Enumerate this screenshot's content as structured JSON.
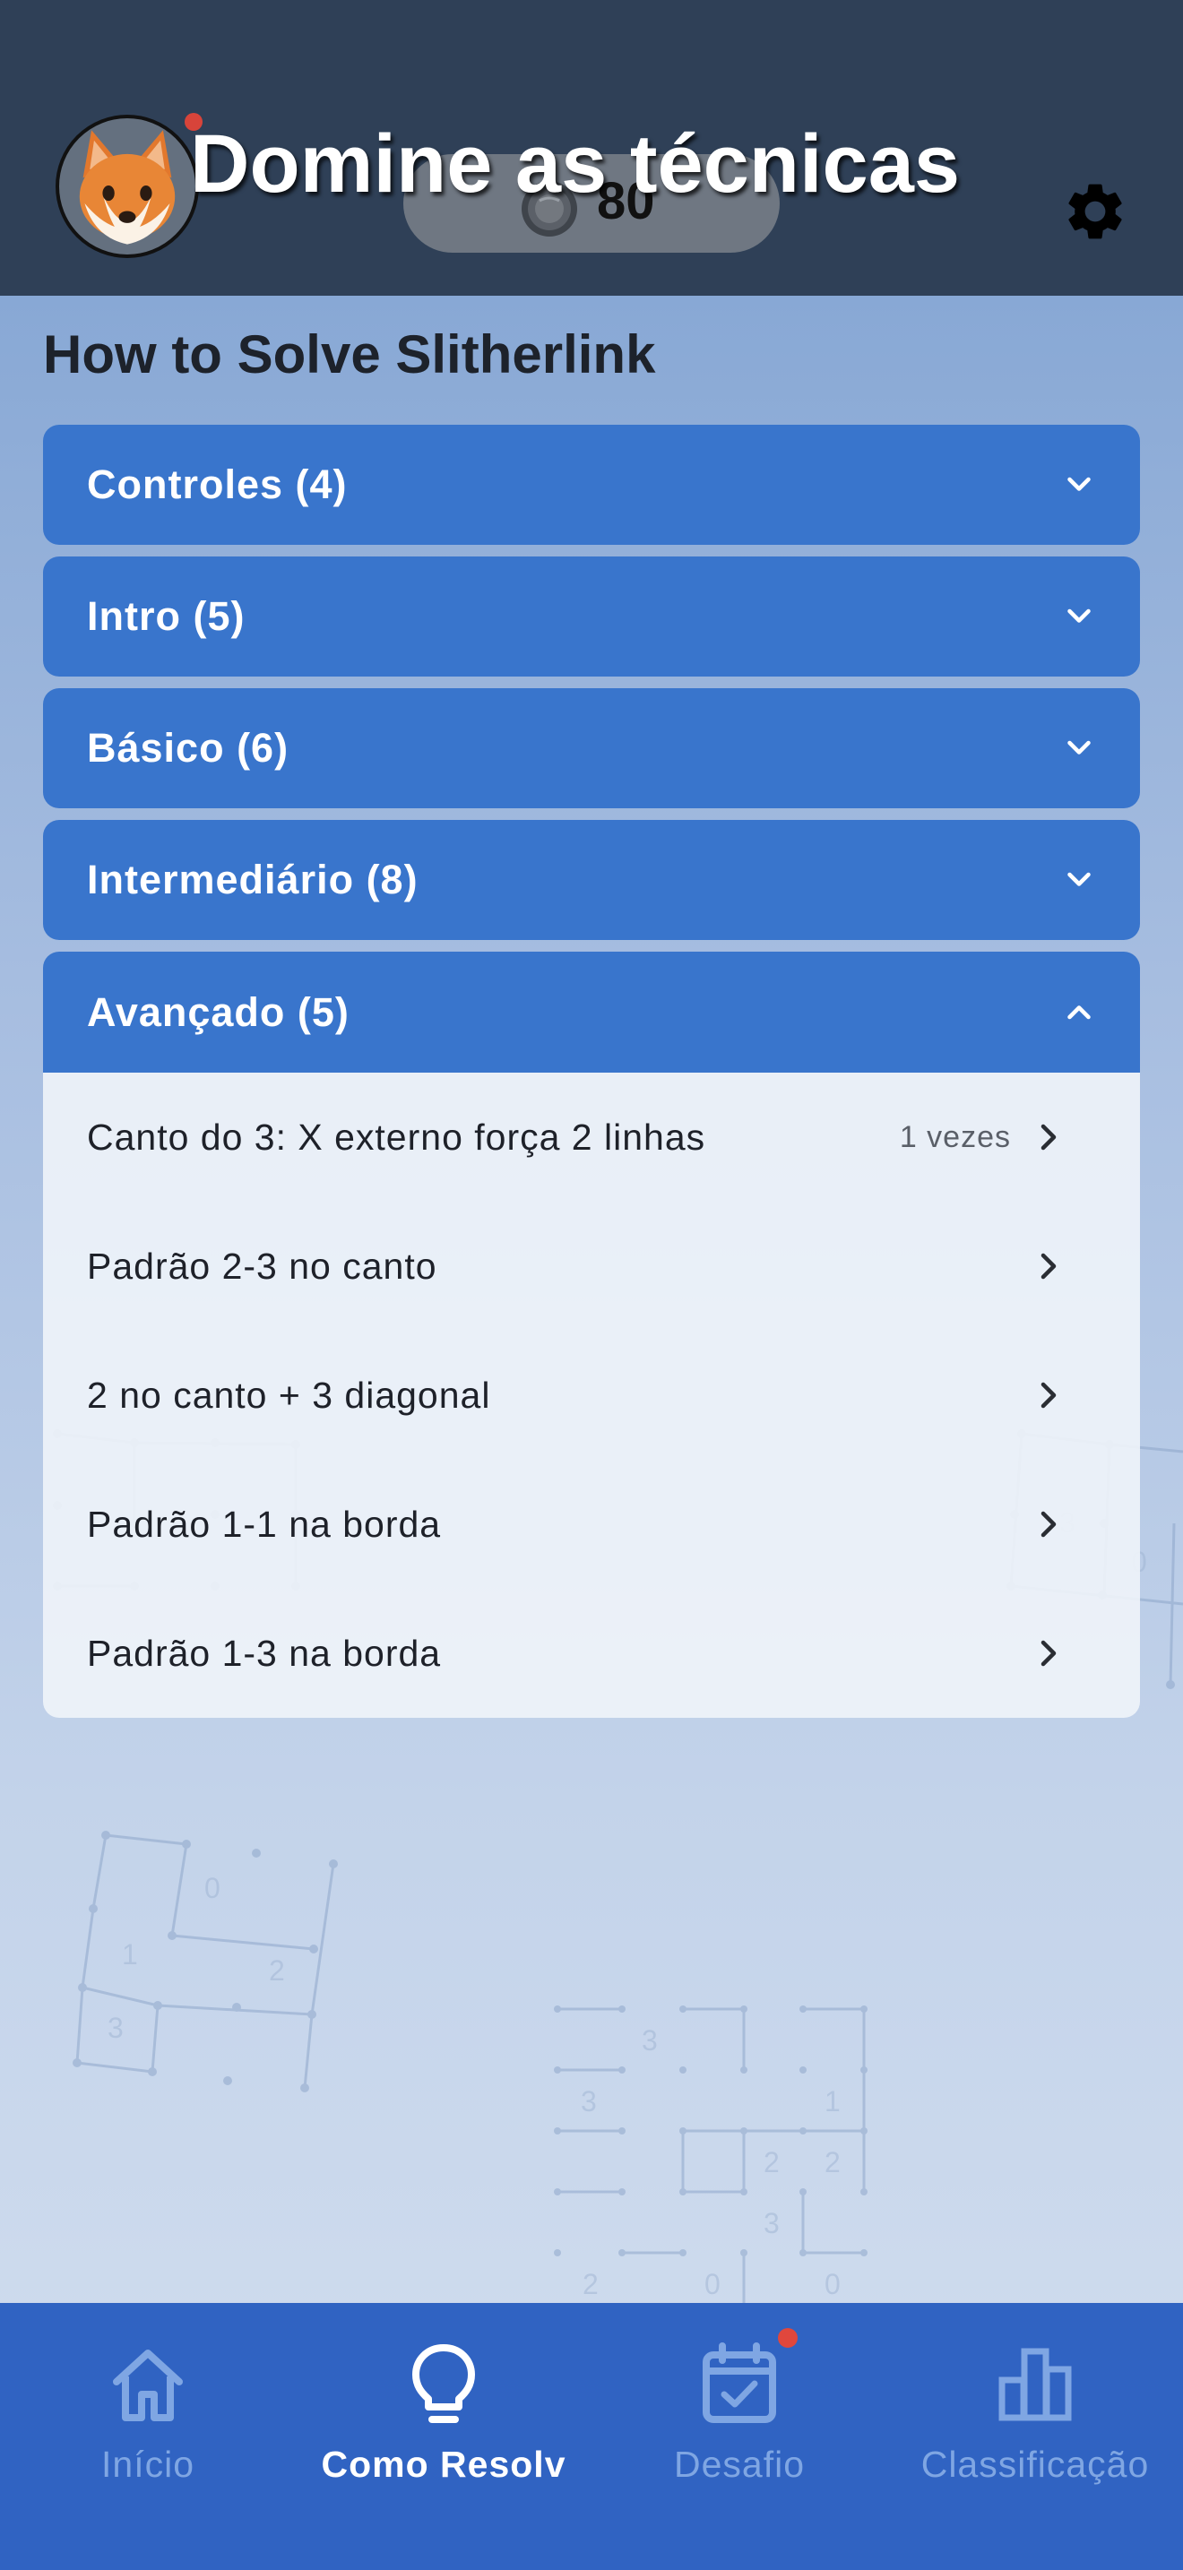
{
  "header": {
    "title": "Domine as técnicas",
    "coins": "80",
    "avatar_icon": "fox-avatar-icon",
    "coin_icon": "coin-icon",
    "settings_icon": "gear-icon"
  },
  "page": {
    "title": "How to Solve Slitherlink"
  },
  "sections": [
    {
      "label": "Controles (4)",
      "expanded": false
    },
    {
      "label": "Intro (5)",
      "expanded": false
    },
    {
      "label": "Básico (6)",
      "expanded": false
    },
    {
      "label": "Intermediário (8)",
      "expanded": false
    },
    {
      "label": "Avançado (5)",
      "expanded": true
    }
  ],
  "advanced_items": [
    {
      "label": "Canto do 3: X externo força 2 linhas",
      "count": "1 vezes"
    },
    {
      "label": "Padrão 2-3 no canto",
      "count": ""
    },
    {
      "label": "2 no canto + 3 diagonal",
      "count": ""
    },
    {
      "label": "Padrão 1-1 na borda",
      "count": ""
    },
    {
      "label": "Padrão 1-3 na borda",
      "count": ""
    }
  ],
  "nav": {
    "items": [
      {
        "label": "Início",
        "icon": "home-icon",
        "active": false
      },
      {
        "label": "Como Resolv",
        "icon": "lightbulb-icon",
        "active": true
      },
      {
        "label": "Desafio",
        "icon": "calendar-check-icon",
        "active": false,
        "badge": true
      },
      {
        "label": "Classificação",
        "icon": "bar-chart-icon",
        "active": false
      }
    ]
  },
  "colors": {
    "header_bg": "#2f4057",
    "section_bg": "#3975cc",
    "nav_bg": "#3063c2",
    "nav_inactive": "#7fa6e3",
    "badge": "#e0473d"
  }
}
